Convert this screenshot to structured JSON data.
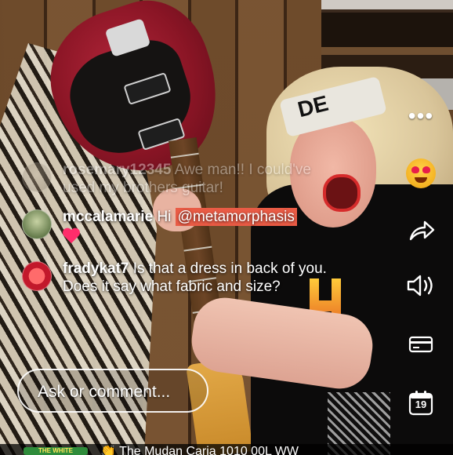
{
  "comments": [
    {
      "username": "rosemary12345",
      "text": "Awe man!! I could've used my brothers guitar!",
      "faded": true
    },
    {
      "username": "mccalamarie",
      "text_prefix": "Hi ",
      "mention": "@metamorphasis",
      "reaction": "heart"
    },
    {
      "username": "fradykat7",
      "text": "Is that a dress in back of you.   Does it say what fabric and size?"
    }
  ],
  "input": {
    "placeholder": "Ask or comment..."
  },
  "side_icons": [
    "more-icon",
    "heart-eyes-emoji-icon",
    "share-icon",
    "sound-icon",
    "card-icon",
    "calendar-icon"
  ],
  "calendar": {
    "day": "19"
  },
  "shirt_print": "DE",
  "bottom": {
    "badge": "THE WHITE",
    "title": "👏 The Mudan Caria 1010 00L WW"
  },
  "colors": {
    "mention_bg": "#e95b45",
    "heart": "#ff2d6b"
  }
}
